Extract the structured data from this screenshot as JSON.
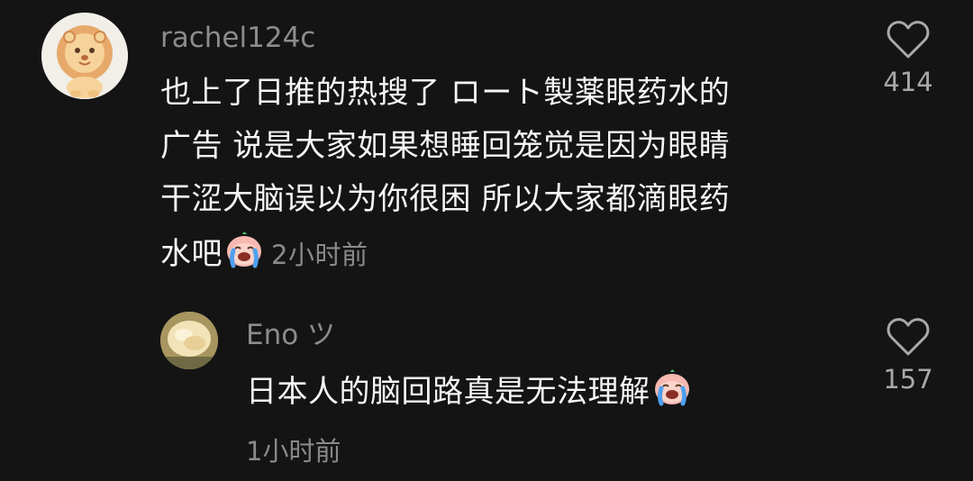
{
  "comments": [
    {
      "username": "rachel124c",
      "lines": [
        "也上了日推的热搜了 ロート製薬眼药水的",
        "广告 说是大家如果想睡回笼觉是因为眼睛",
        "干涩大脑误以为你很困 所以大家都滴眼药"
      ],
      "last_line": "水吧",
      "time": "2小时前",
      "likes": "414",
      "avatar_icon": "lion-avatar",
      "emoji_icon": "crying-face-emoji"
    }
  ],
  "replies": [
    {
      "username": "Eno ツ",
      "text": "日本人的脑回路真是无法理解",
      "time": "1小时前",
      "likes": "157",
      "avatar_icon": "bread-avatar",
      "emoji_icon": "crying-face-emoji"
    }
  ],
  "colors": {
    "background": "#141414",
    "username": "#8c8c8c",
    "text": "#f5f5f5",
    "meta": "#8a8a8a",
    "heart": "#a9a9a9"
  }
}
